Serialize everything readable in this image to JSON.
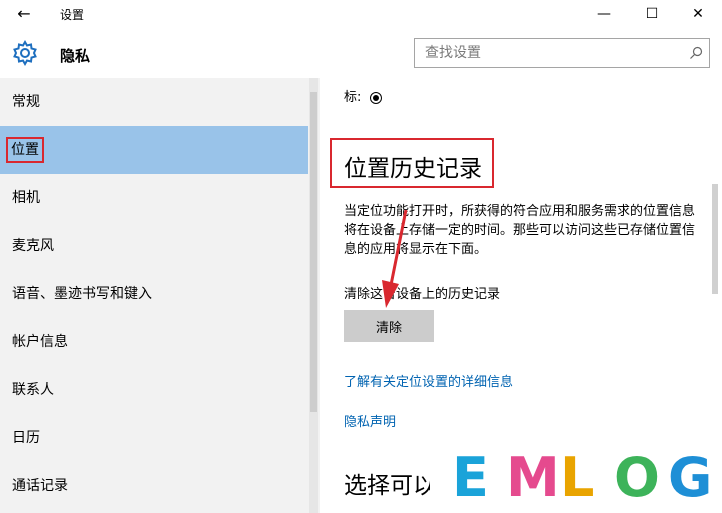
{
  "window": {
    "title": "设置",
    "back_icon": "back-arrow-icon",
    "controls": [
      "minimize-icon",
      "maximize-icon",
      "close-icon"
    ]
  },
  "header": {
    "title": "隐私",
    "icon": "gear-icon",
    "search": {
      "placeholder": "查找设置",
      "value": ""
    }
  },
  "sidebar": {
    "selected_index": 1,
    "items": [
      {
        "label": "常规"
      },
      {
        "label": "位置"
      },
      {
        "label": "相机"
      },
      {
        "label": "麦克风"
      },
      {
        "label": "语音、墨迹书写和键入"
      },
      {
        "label": "帐户信息"
      },
      {
        "label": "联系人"
      },
      {
        "label": "日历"
      },
      {
        "label": "通话记录"
      }
    ]
  },
  "main": {
    "partial_top": "标:",
    "history": {
      "title": "位置历史记录",
      "description": "当定位功能打开时，所获得的符合应用和服务需求的位置信息将在设备上存储一定的时间。那些可以访问这些已存储位置信息的应用将显示在下面。",
      "clear_label": "清除这台设备上的历史记录",
      "clear_button": "清除"
    },
    "links": {
      "learn_more": "了解有关定位设置的详细信息",
      "privacy_statement": "隐私声明"
    },
    "section2_title": "选择可以"
  },
  "watermark": {
    "text": "EMLOG",
    "letters": [
      {
        "char": "E",
        "color": "#1aa3d9"
      },
      {
        "char": "M",
        "color": "#e54a8e"
      },
      {
        "char": "L",
        "color": "#e9a400"
      },
      {
        "char": "O",
        "color": "#3db35a"
      },
      {
        "char": "G",
        "color": "#1e8fd6"
      }
    ]
  },
  "colors": {
    "selection": "#99c3e9",
    "highlight_box": "#d9282f",
    "link": "#0063b1",
    "sidebar_bg": "#f2f2f2"
  }
}
